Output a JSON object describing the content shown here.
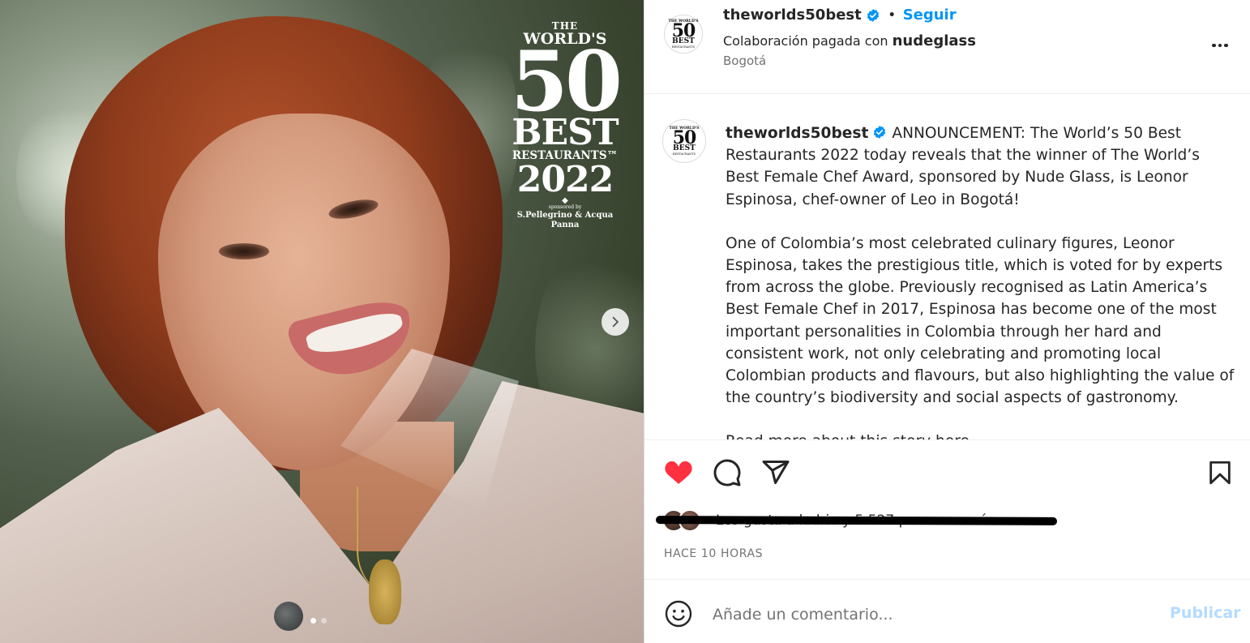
{
  "media": {
    "logo": {
      "the": "THE",
      "worlds": "WORLD'S",
      "number": "50",
      "best": "BEST",
      "restaurants": "RESTAURANTS™",
      "year": "2022",
      "sponsored_by": "sponsored by",
      "sponsor": "S.Pellegrino & Acqua Panna"
    },
    "slide_count": 2,
    "active_slide": 1,
    "next_icon": "chevron-right-icon"
  },
  "header": {
    "username": "theworlds50best",
    "separator": "•",
    "follow_label": "Seguir",
    "collab_prefix": "Colaboración pagada con",
    "collab_partner": "nudeglass",
    "location": "Bogotá",
    "verified_color": "#0095f6"
  },
  "caption": {
    "username": "theworlds50best",
    "paragraph1": "ANNOUNCEMENT: The World’s 50 Best Restaurants 2022 today reveals that the winner of The World’s Best Female Chef Award, sponsored by Nude Glass, is Leonor Espinosa, chef-owner of Leo in Bogotá!",
    "paragraph2": "One of Colombia’s most celebrated culinary figures, Leonor Espinosa, takes the prestigious title, which is voted for by experts from across the globe. Previously recognised as Latin America’s Best Female Chef in 2017, Espinosa has become one of the most important personalities in Colombia through her hard and consistent work, not only celebrating and promoting local Colombian products and flavours, but also highlighting the value of the country’s biodiversity and social aspects of gastronomy.",
    "paragraph3": "Read more about this story here..."
  },
  "actions": {
    "liked": true,
    "like_color": "#ff3040",
    "icons": [
      "heart-icon",
      "comment-icon",
      "share-icon",
      "bookmark-icon"
    ]
  },
  "likes": {
    "text": "Les gusta a ladrio y 5.527 personas más",
    "redacted": true
  },
  "timestamp": "HACE 10 HORAS",
  "comment": {
    "placeholder": "Añade un comentario...",
    "publish_label": "Publicar",
    "publish_color": "#b3dbff"
  },
  "avatar_logo": {
    "the": "THE WORLD'S",
    "number": "50",
    "best": "BEST",
    "restaurants": "RESTAURANTS"
  }
}
